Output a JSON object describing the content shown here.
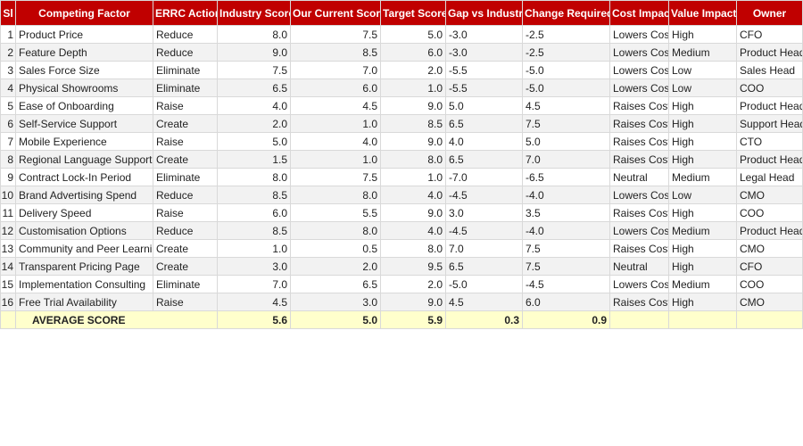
{
  "headers": {
    "sl": "Sl",
    "factor": "Competing Factor",
    "errc": "ERRC Action",
    "industry": "Industry Score",
    "current": "Our Current Score",
    "target": "Target Score",
    "gap": "Gap vs Industry",
    "change": "Change Required",
    "cost": "Cost Impact",
    "value": "Value Impact",
    "owner": "Owner"
  },
  "rows": [
    {
      "sl": "1",
      "factor": "Product Price",
      "errc": "Reduce",
      "industry": "8.0",
      "current": "7.5",
      "target": "5.0",
      "gap": "-3.0",
      "change": "-2.5",
      "cost": "Lowers Cost",
      "value": "High",
      "owner": "CFO"
    },
    {
      "sl": "2",
      "factor": "Feature Depth",
      "errc": "Reduce",
      "industry": "9.0",
      "current": "8.5",
      "target": "6.0",
      "gap": "-3.0",
      "change": "-2.5",
      "cost": "Lowers Cost",
      "value": "Medium",
      "owner": "Product Head"
    },
    {
      "sl": "3",
      "factor": "Sales Force Size",
      "errc": "Eliminate",
      "industry": "7.5",
      "current": "7.0",
      "target": "2.0",
      "gap": "-5.5",
      "change": "-5.0",
      "cost": "Lowers Cost",
      "value": "Low",
      "owner": "Sales Head"
    },
    {
      "sl": "4",
      "factor": "Physical Showrooms",
      "errc": "Eliminate",
      "industry": "6.5",
      "current": "6.0",
      "target": "1.0",
      "gap": "-5.5",
      "change": "-5.0",
      "cost": "Lowers Cost",
      "value": "Low",
      "owner": "COO"
    },
    {
      "sl": "5",
      "factor": "Ease of Onboarding",
      "errc": "Raise",
      "industry": "4.0",
      "current": "4.5",
      "target": "9.0",
      "gap": "5.0",
      "change": "4.5",
      "cost": "Raises Cost",
      "value": "High",
      "owner": "Product Head"
    },
    {
      "sl": "6",
      "factor": "Self-Service Support",
      "errc": "Create",
      "industry": "2.0",
      "current": "1.0",
      "target": "8.5",
      "gap": "6.5",
      "change": "7.5",
      "cost": "Raises Cost",
      "value": "High",
      "owner": "Support Head"
    },
    {
      "sl": "7",
      "factor": "Mobile Experience",
      "errc": "Raise",
      "industry": "5.0",
      "current": "4.0",
      "target": "9.0",
      "gap": "4.0",
      "change": "5.0",
      "cost": "Raises Cost",
      "value": "High",
      "owner": "CTO"
    },
    {
      "sl": "8",
      "factor": "Regional Language Support",
      "errc": "Create",
      "industry": "1.5",
      "current": "1.0",
      "target": "8.0",
      "gap": "6.5",
      "change": "7.0",
      "cost": "Raises Cost",
      "value": "High",
      "owner": "Product Head"
    },
    {
      "sl": "9",
      "factor": "Contract Lock-In Period",
      "errc": "Eliminate",
      "industry": "8.0",
      "current": "7.5",
      "target": "1.0",
      "gap": "-7.0",
      "change": "-6.5",
      "cost": "Neutral",
      "value": "Medium",
      "owner": "Legal Head"
    },
    {
      "sl": "10",
      "factor": "Brand Advertising Spend",
      "errc": "Reduce",
      "industry": "8.5",
      "current": "8.0",
      "target": "4.0",
      "gap": "-4.5",
      "change": "-4.0",
      "cost": "Lowers Cost",
      "value": "Low",
      "owner": "CMO"
    },
    {
      "sl": "11",
      "factor": "Delivery Speed",
      "errc": "Raise",
      "industry": "6.0",
      "current": "5.5",
      "target": "9.0",
      "gap": "3.0",
      "change": "3.5",
      "cost": "Raises Cost",
      "value": "High",
      "owner": "COO"
    },
    {
      "sl": "12",
      "factor": "Customisation Options",
      "errc": "Reduce",
      "industry": "8.5",
      "current": "8.0",
      "target": "4.0",
      "gap": "-4.5",
      "change": "-4.0",
      "cost": "Lowers Cost",
      "value": "Medium",
      "owner": "Product Head"
    },
    {
      "sl": "13",
      "factor": "Community and Peer Learning",
      "errc": "Create",
      "industry": "1.0",
      "current": "0.5",
      "target": "8.0",
      "gap": "7.0",
      "change": "7.5",
      "cost": "Raises Cost",
      "value": "High",
      "owner": "CMO"
    },
    {
      "sl": "14",
      "factor": "Transparent Pricing Page",
      "errc": "Create",
      "industry": "3.0",
      "current": "2.0",
      "target": "9.5",
      "gap": "6.5",
      "change": "7.5",
      "cost": "Neutral",
      "value": "High",
      "owner": "CFO"
    },
    {
      "sl": "15",
      "factor": "Implementation Consulting",
      "errc": "Eliminate",
      "industry": "7.0",
      "current": "6.5",
      "target": "2.0",
      "gap": "-5.0",
      "change": "-4.5",
      "cost": "Lowers Cost",
      "value": "Medium",
      "owner": "COO"
    },
    {
      "sl": "16",
      "factor": "Free Trial Availability",
      "errc": "Raise",
      "industry": "4.5",
      "current": "3.0",
      "target": "9.0",
      "gap": "4.5",
      "change": "6.0",
      "cost": "Raises Cost",
      "value": "High",
      "owner": "CMO"
    }
  ],
  "average": {
    "label": "AVERAGE SCORE",
    "industry": "5.6",
    "current": "5.0",
    "target": "5.9",
    "gap": "0.3",
    "change": "0.9"
  },
  "colors": {
    "header_bg": "#c00000",
    "header_text": "#ffffff",
    "average_row_bg": "#ffffcc",
    "alt_row_bg": "#f2f2f2"
  }
}
